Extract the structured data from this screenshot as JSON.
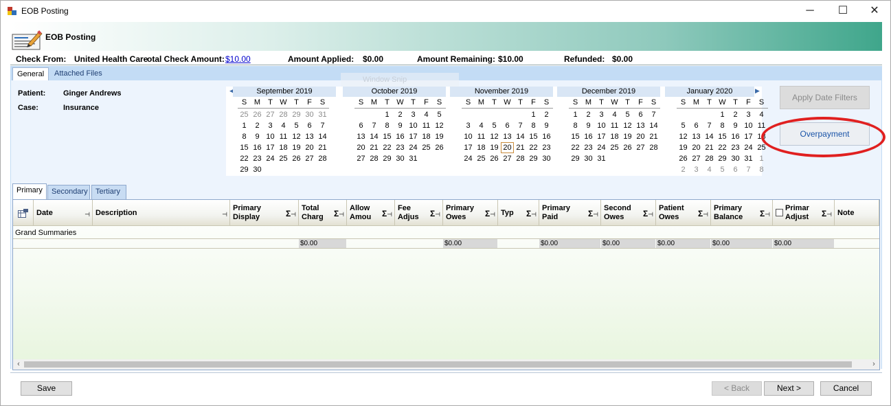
{
  "window": {
    "title": "EOB Posting",
    "controls": {
      "minimize": "─",
      "maximize": "☐",
      "close": "✕"
    }
  },
  "header": {
    "title": "EOB Posting"
  },
  "check": {
    "from_label": "Check From:",
    "from_value": "United Health Care",
    "total_label": "otal Check Amount:",
    "total_value": "$10.00",
    "applied_label": "Amount Applied:",
    "applied_value": "$0.00",
    "remaining_label": "Amount Remaining:",
    "remaining_value": "$10.00",
    "refunded_label": "Refunded:",
    "refunded_value": "$0.00"
  },
  "tabs": [
    "General",
    "Attached Files"
  ],
  "snip_ghost": "Window Snip",
  "patient": {
    "patient_label": "Patient:",
    "patient_value": "Ginger Andrews",
    "case_label": "Case:",
    "case_value": "Insurance"
  },
  "calendar": {
    "nav_prev": "◀",
    "nav_next": "▶",
    "dow": [
      "S",
      "M",
      "T",
      "W",
      "T",
      "F",
      "S"
    ],
    "today": "20",
    "months": [
      {
        "title": "September 2019",
        "rows": [
          [
            "25",
            "26",
            "27",
            "28",
            "29",
            "30",
            "31"
          ],
          [
            "1",
            "2",
            "3",
            "4",
            "5",
            "6",
            "7"
          ],
          [
            "8",
            "9",
            "10",
            "11",
            "12",
            "13",
            "14"
          ],
          [
            "15",
            "16",
            "17",
            "18",
            "19",
            "20",
            "21"
          ],
          [
            "22",
            "23",
            "24",
            "25",
            "26",
            "27",
            "28"
          ],
          [
            "29",
            "30",
            "",
            "",
            "",
            "",
            ""
          ]
        ],
        "other_prefix": 7,
        "other_suffix_from": 99
      },
      {
        "title": "October 2019",
        "rows": [
          [
            "",
            "",
            "1",
            "2",
            "3",
            "4",
            "5"
          ],
          [
            "6",
            "7",
            "8",
            "9",
            "10",
            "11",
            "12"
          ],
          [
            "13",
            "14",
            "15",
            "16",
            "17",
            "18",
            "19"
          ],
          [
            "20",
            "21",
            "22",
            "23",
            "24",
            "25",
            "26"
          ],
          [
            "27",
            "28",
            "29",
            "30",
            "31",
            "",
            ""
          ],
          [
            "",
            "",
            "",
            "",
            "",
            "",
            ""
          ]
        ],
        "other_prefix": 0,
        "other_suffix_from": 99
      },
      {
        "title": "November 2019",
        "rows": [
          [
            "",
            "",
            "",
            "",
            "",
            "1",
            "2"
          ],
          [
            "3",
            "4",
            "5",
            "6",
            "7",
            "8",
            "9"
          ],
          [
            "10",
            "11",
            "12",
            "13",
            "14",
            "15",
            "16"
          ],
          [
            "17",
            "18",
            "19",
            "20",
            "21",
            "22",
            "23"
          ],
          [
            "24",
            "25",
            "26",
            "27",
            "28",
            "29",
            "30"
          ],
          [
            "",
            "",
            "",
            "",
            "",
            "",
            ""
          ]
        ],
        "other_prefix": 0,
        "other_suffix_from": 99
      },
      {
        "title": "December 2019",
        "rows": [
          [
            "1",
            "2",
            "3",
            "4",
            "5",
            "6",
            "7"
          ],
          [
            "8",
            "9",
            "10",
            "11",
            "12",
            "13",
            "14"
          ],
          [
            "15",
            "16",
            "17",
            "18",
            "19",
            "20",
            "21"
          ],
          [
            "22",
            "23",
            "24",
            "25",
            "26",
            "27",
            "28"
          ],
          [
            "29",
            "30",
            "31",
            "",
            "",
            "",
            ""
          ],
          [
            "",
            "",
            "",
            "",
            "",
            "",
            ""
          ]
        ],
        "other_prefix": 0,
        "other_suffix_from": 99
      },
      {
        "title": "January 2020",
        "rows": [
          [
            "",
            "",
            "",
            "1",
            "2",
            "3",
            "4"
          ],
          [
            "5",
            "6",
            "7",
            "8",
            "9",
            "10",
            "11"
          ],
          [
            "12",
            "13",
            "14",
            "15",
            "16",
            "17",
            "18"
          ],
          [
            "19",
            "20",
            "21",
            "22",
            "23",
            "24",
            "25"
          ],
          [
            "26",
            "27",
            "28",
            "29",
            "30",
            "31",
            "1"
          ],
          [
            "2",
            "3",
            "4",
            "5",
            "6",
            "7",
            "8"
          ]
        ],
        "other_prefix": 0,
        "other_suffix_from": 34
      }
    ]
  },
  "buttons": {
    "apply_date_filters": "Apply Date Filters",
    "overpayment": "Overpayment",
    "save": "Save",
    "back": "< Back",
    "next": "Next >",
    "cancel": "Cancel"
  },
  "subtabs": [
    "Primary",
    "Secondary",
    "Tertiary"
  ],
  "grid": {
    "sigma": "Σ",
    "pin": "⊣",
    "columns": [
      {
        "l1": "Date",
        "l2": ""
      },
      {
        "l1": "Description",
        "l2": ""
      },
      {
        "l1": "Primary",
        "l2": "Display"
      },
      {
        "l1": "Total",
        "l2": "Charg"
      },
      {
        "l1": "Allow",
        "l2": "Amou"
      },
      {
        "l1": "Fee",
        "l2": "Adjus"
      },
      {
        "l1": "Primary",
        "l2": "Owes"
      },
      {
        "l1": "Typ",
        "l2": ""
      },
      {
        "l1": "Primary",
        "l2": "Paid"
      },
      {
        "l1": "Second",
        "l2": "Owes"
      },
      {
        "l1": "Patient",
        "l2": "Owes"
      },
      {
        "l1": "Primary",
        "l2": "Balance"
      },
      {
        "l1": "Primar",
        "l2": "Adjust"
      },
      {
        "l1": "Note",
        "l2": ""
      }
    ],
    "grand_summaries": "Grand Summaries",
    "summary_values": {
      "total_charge": "$0.00",
      "primary_owes": "$0.00",
      "primary_paid": "$0.00",
      "second_owes": "$0.00",
      "patient_owes": "$0.00",
      "primary_balance": "$0.00",
      "primary_adjust": "$0.00"
    },
    "scroll_left": "‹",
    "scroll_right": "›"
  }
}
